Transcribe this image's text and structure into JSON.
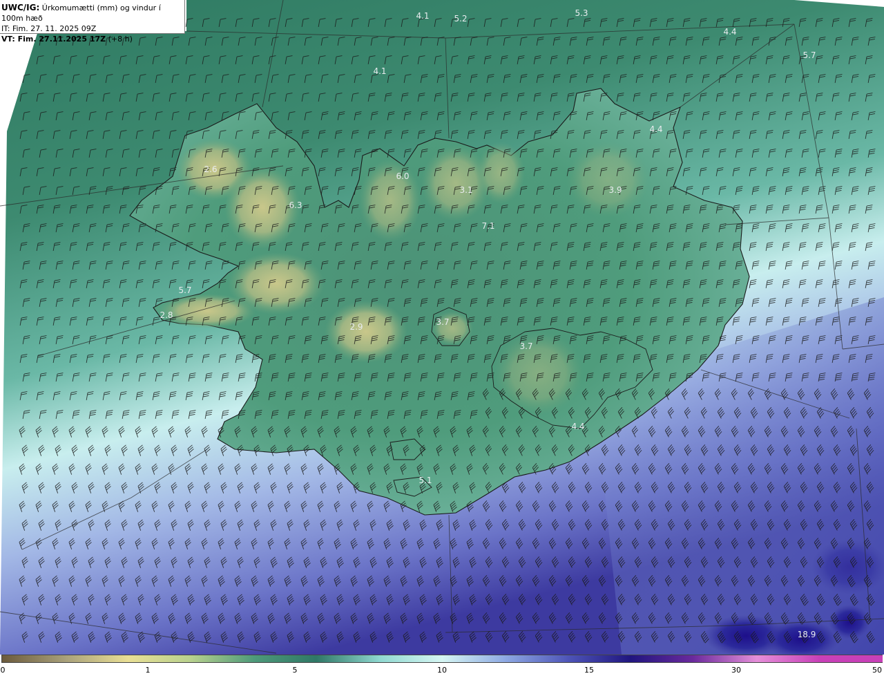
{
  "header": {
    "model": "UWC/IG:",
    "title": " Úrkomumætti (mm) og vindur í 100m hæð",
    "init_time": "IT: Fim. 27. 11. 2025 09Z",
    "valid_prefix": "VT: Fim. 27.11.2025 17Z",
    "valid_suffix": " (+8 h)"
  },
  "map_labels": [
    {
      "text": "4.1"
    },
    {
      "text": "5.2"
    },
    {
      "text": "5.3"
    },
    {
      "text": "4.4"
    },
    {
      "text": "5.7"
    },
    {
      "text": "4.1"
    },
    {
      "text": "4.4"
    },
    {
      "text": "2.6"
    },
    {
      "text": "6.3"
    },
    {
      "text": "6.0"
    },
    {
      "text": "3.1"
    },
    {
      "text": "3.9"
    },
    {
      "text": "7.1"
    },
    {
      "text": "5.7"
    },
    {
      "text": "2.8"
    },
    {
      "text": "2.9"
    },
    {
      "text": "3.7"
    },
    {
      "text": "3.7"
    },
    {
      "text": "4.4"
    },
    {
      "text": "5.1"
    },
    {
      "text": "18.9"
    }
  ],
  "colorbar": {
    "ticks": [
      "0",
      "1",
      "5",
      "10",
      "15",
      "30",
      "50"
    ],
    "colors": [
      "#6b5a3c",
      "#a8a07a",
      "#e9df95",
      "#b8d18e",
      "#4e9a7a",
      "#2f7766",
      "#8fd8d0",
      "#d6f6f3",
      "#8ea9e3",
      "#4e55b8",
      "#20157f",
      "#6b2a9d",
      "#e58fd9",
      "#c840b8"
    ]
  },
  "colors": {
    "land_high": "#c9c78a",
    "land_mid": "#4f9a79",
    "sea_green": "#3f8a70",
    "sea_light": "#cdeff0",
    "sea_blue": "#6b7fd0",
    "sea_dark": "#27138a"
  },
  "icons": [
    "wind-barb-icon",
    "coastline-outline"
  ]
}
